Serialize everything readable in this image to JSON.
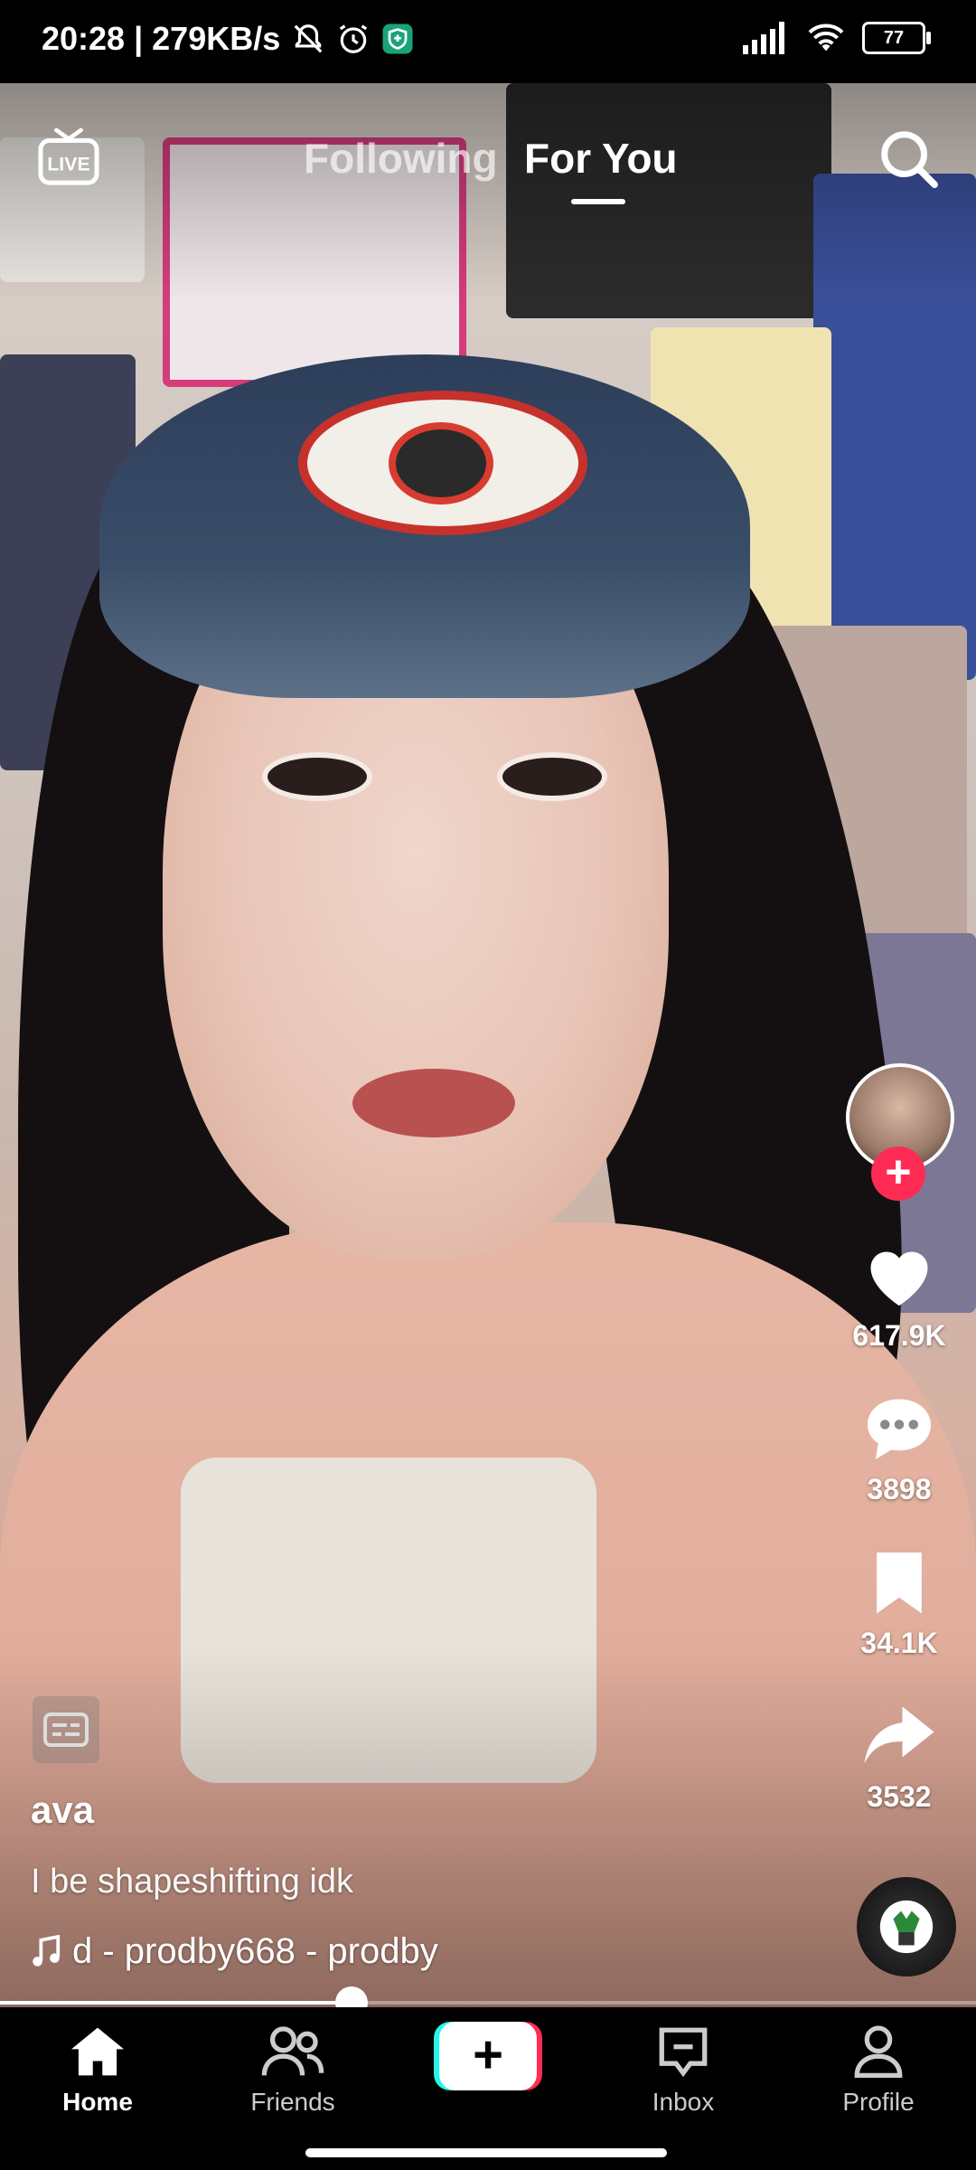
{
  "status_bar": {
    "time_speed": "20:28 | 279KB/s",
    "battery": "77"
  },
  "top_nav": {
    "live_label": "LIVE",
    "tabs": [
      {
        "label": "Following",
        "active": false
      },
      {
        "label": "For You",
        "active": true
      }
    ]
  },
  "video": {
    "username": "ava",
    "description": "I be shapeshifting idk",
    "sound": "d - prodby668 - prodby",
    "progress": 0.36
  },
  "actions": {
    "likes": "617.9K",
    "comments": "3898",
    "saves": "34.1K",
    "shares": "3532"
  },
  "bottom_nav": {
    "home": "Home",
    "friends": "Friends",
    "create": "+",
    "inbox": "Inbox",
    "profile": "Profile"
  },
  "colors": {
    "accent_red": "#fe2c55",
    "accent_cyan": "#25f4ee"
  },
  "icons": [
    "bell-off-icon",
    "alarm-icon",
    "shield-icon",
    "signal-icon",
    "wifi-icon",
    "battery-icon",
    "live-tv-icon",
    "search-icon",
    "heart-icon",
    "comment-icon",
    "bookmark-icon",
    "share-icon",
    "music-note-icon",
    "captions-icon",
    "home-icon",
    "friends-icon",
    "inbox-icon",
    "profile-icon"
  ]
}
